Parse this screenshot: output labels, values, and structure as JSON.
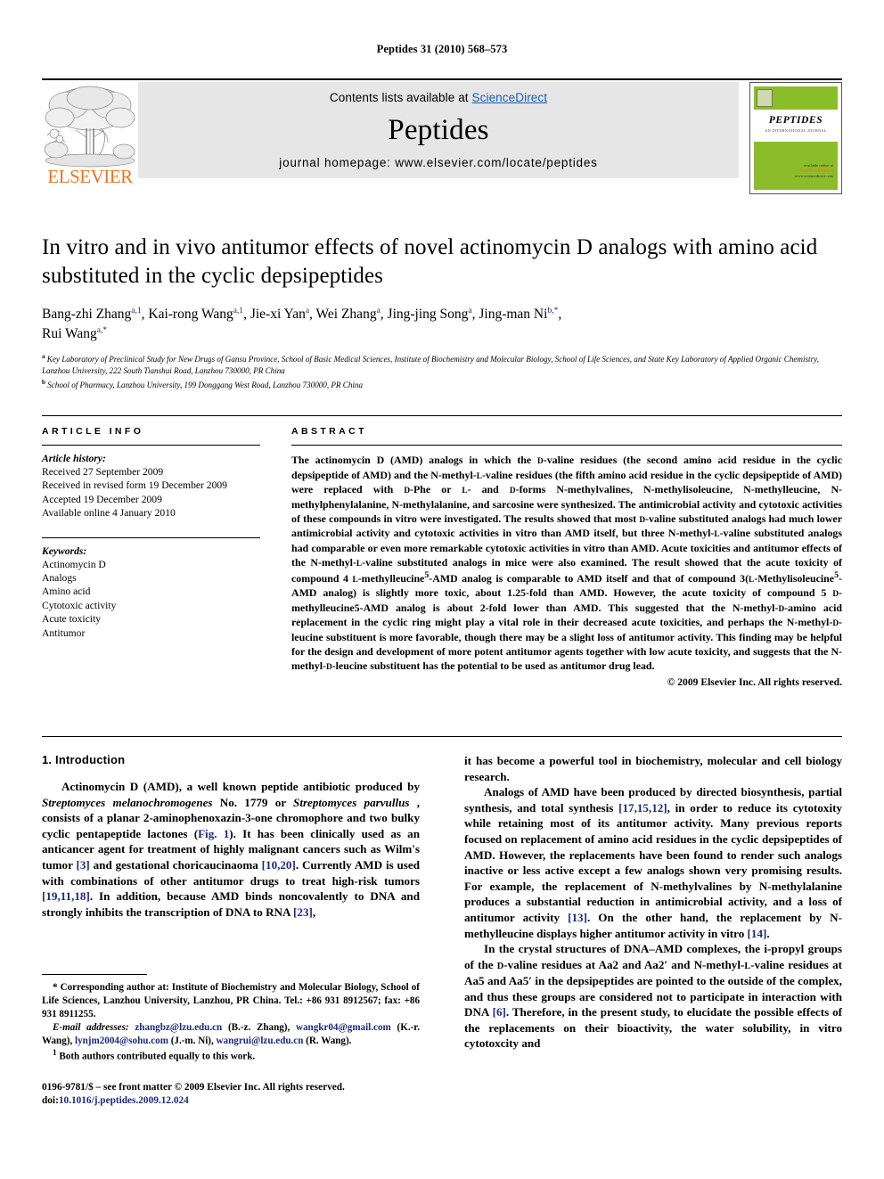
{
  "running_head": "Peptides 31 (2010) 568–573",
  "masthead": {
    "contents_prefix": "Contents lists available at ",
    "sciencedirect": "ScienceDirect",
    "journal_name": "Peptides",
    "homepage": "journal homepage: www.elsevier.com/locate/peptides",
    "publisher": "ELSEVIER",
    "cover": {
      "title": "PEPTIDES",
      "subtitle": "AN INTERNATIONAL JOURNAL",
      "sd_label": "available online at",
      "sd_name": "ScienceDirect",
      "sd_url": "www.sciencedirect.com"
    },
    "accent_green": "#8bbd2b",
    "accent_orange": "#e87722",
    "link_blue": "#1a5fb4"
  },
  "article": {
    "title": "In vitro and in vivo antitumor effects of novel actinomycin D analogs with amino acid substituted in the cyclic depsipeptides",
    "authors_line1": "Bang-zhi Zhang<sup>a,1</sup>, Kai-rong Wang<sup>a,1</sup>, Jie-xi Yan<sup>a</sup>, Wei Zhang<sup>a</sup>, Jing-jing Song<sup>a</sup>, Jing-man Ni<sup>b,*</sup>,",
    "authors_line2": "Rui Wang<sup>a,*</sup>",
    "affiliation_a": "Key Laboratory of Preclinical Study for New Drugs of Gansu Province, School of Basic Medical Sciences, Institute of Biochemistry and Molecular Biology, School of Life Sciences, and State Key Laboratory of Applied Organic Chemistry, Lanzhou University, 222 South Tianshui Road, Lanzhou 730000, PR China",
    "affiliation_b": "School of Pharmacy, Lanzhou University, 199 Donggang West Road, Lanzhou 730000, PR China"
  },
  "article_info": {
    "heading": "ARTICLE INFO",
    "history_label": "Article history:",
    "history": [
      "Received 27 September 2009",
      "Received in revised form 19 December 2009",
      "Accepted 19 December 2009",
      "Available online 4 January 2010"
    ],
    "keywords_label": "Keywords:",
    "keywords": [
      "Actinomycin D",
      "Analogs",
      "Amino acid",
      "Cytotoxic activity",
      "Acute toxicity",
      "Antitumor"
    ]
  },
  "abstract": {
    "heading": "ABSTRACT",
    "text": "The actinomycin D (AMD) analogs in which the <span class=\"smallcap\">D</span>-valine residues (the second amino acid residue in the cyclic depsipeptide of AMD) and the N-methyl-<span class=\"smallcap\">L</span>-valine residues (the fifth amino acid residue in the cyclic depsipeptide of AMD) were replaced with <span class=\"smallcap\">D</span>-Phe or <span class=\"smallcap\">L</span>- and <span class=\"smallcap\">D</span>-forms N-methylvalines, N-methylisoleucine, N-methylleucine, N-methylphenylalanine, N-methylalanine, and sarcosine were synthesized. The antimicrobial activity and cytotoxic activities of these compounds in vitro were investigated. The results showed that most <span class=\"smallcap\">D</span>-valine substituted analogs had much lower antimicrobial activity and cytotoxic activities in vitro than AMD itself, but three N-methyl-<span class=\"smallcap\">L</span>-valine substituted analogs had comparable or even more remarkable cytotoxic activities in vitro than AMD. Acute toxicities and antitumor effects of the N-methyl-<span class=\"smallcap\">L</span>-valine substituted analogs in mice were also examined. The result showed that the acute toxicity of compound 4 <span class=\"smallcap\">L</span>-methylleucine<sup>5</sup>-AMD analog is comparable to AMD itself and that of compound 3(<span class=\"smallcap\">L</span>-Methylisoleucine<sup>5</sup>-AMD analog) is slightly more toxic, about 1.25-fold than AMD. However, the acute toxicity of compound 5 <span class=\"smallcap\">D</span>-methylleucine5-AMD analog is about 2-fold lower than AMD. This suggested that the N-methyl-<span class=\"smallcap\">D</span>-amino acid replacement in the cyclic ring might play a vital role in their decreased acute toxicities, and perhaps the N-methyl-<span class=\"smallcap\">D</span>-leucine substituent is more favorable, though there may be a slight loss of antitumor activity. This finding may be helpful for the design and development of more potent antitumor agents together with low acute toxicity, and suggests that the N-methyl-<span class=\"smallcap\">D</span>-leucine substituent has the potential to be used as antitumor drug lead.",
    "copyright": "© 2009 Elsevier Inc. All rights reserved."
  },
  "introduction": {
    "heading": "1. Introduction",
    "left_para1": "Actinomycin D (AMD), a well known peptide antibiotic produced by <i>Streptomyces melanochromogenes</i> No. 1779 or <i>Streptomyces parvullus</i> , consists of a planar 2-aminophenoxazin-3-one chromophore and two bulky cyclic pentapeptide lactones (<span class=\"ref\">Fig. 1</span>). It has been clinically used as an anticancer agent for treatment of highly malignant cancers such as Wilm's tumor <span class=\"ref\">[3]</span> and gestational choricaucinaoma <span class=\"ref\">[10,20]</span>. Currently AMD is used with combinations of other antitumor drugs to treat high-risk tumors <span class=\"ref\">[19,11,18]</span>. In addition, because AMD binds noncovalently to DNA and strongly inhibits the transcription of DNA to RNA <span class=\"ref\">[23]</span>,",
    "right_para1": "it has become a powerful tool in biochemistry, molecular and cell biology research.",
    "right_para2": "Analogs of AMD have been produced by directed biosynthesis, partial synthesis, and total synthesis <span class=\"ref\">[17,15,12]</span>, in order to reduce its cytotoxity while retaining most of its antitumor activity. Many previous reports focused on replacement of amino acid residues in the cyclic depsipeptides of AMD. However, the replacements have been found to render such analogs inactive or less active except a few analogs shown very promising results. For example, the replacement of N-methylvalines by N-methylalanine produces a substantial reduction in antimicrobial activity, and a loss of antitumor activity <span class=\"ref\">[13]</span>. On the other hand, the replacement by N-methylleucine displays higher antitumor activity in vitro <span class=\"ref\">[14]</span>.",
    "right_para3": "In the crystal structures of DNA–AMD complexes, the i-propyl groups of the <span class=\"sc\">D</span>-valine residues at Aa2 and Aa2′ and N-methyl-<span class=\"sc\">L</span>-valine residues at Aa5 and Aa5′ in the depsipeptides are pointed to the outside of the complex, and thus these groups are considered not to participate in interaction with DNA <span class=\"ref\">[6]</span>. Therefore, in the present study, to elucidate the possible effects of the replacements on their bioactivity, the water solubility, in vitro cytotoxcity and"
  },
  "footnotes": {
    "corresponding": "* Corresponding author at: Institute of Biochemistry and Molecular Biology, School of Life Sciences, Lanzhou University, Lanzhou, PR China. Tel.: +86 931 8912567; fax: +86 931 8911255.",
    "emails": "<span class=\"email-label\">E-mail addresses:</span> <span class=\"mail\">zhangbz@lzu.edu.cn</span> (B.-z. Zhang), <span class=\"mail\">wangkr04@gmail.com</span> (K.-r. Wang), <span class=\"mail\">lynjm2004@sohu.com</span> (J.-m. Ni), <span class=\"mail\">wangrui@lzu.edu.cn</span> (R. Wang).",
    "equal_contrib": "<sup>1</sup> Both authors contributed equally to this work."
  },
  "footer": {
    "issn_line": "0196-9781/$ – see front matter © 2009 Elsevier Inc. All rights reserved.",
    "doi_label": "doi:",
    "doi": "10.1016/j.peptides.2009.12.024"
  }
}
